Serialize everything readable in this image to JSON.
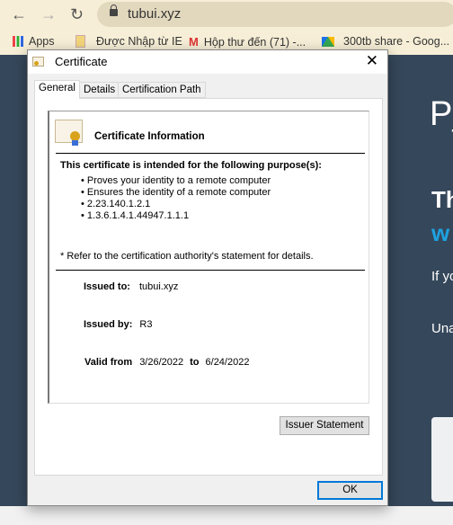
{
  "browser": {
    "url": "tubui.xyz",
    "bookmarks": [
      "Apps",
      "Được Nhập từ IE",
      "Hộp thư đến (71) -...",
      "300tb share - Goog..."
    ]
  },
  "page": {
    "logo": "P_",
    "heading1": "Th",
    "heading2": "w",
    "text1": "If yo",
    "text2": "Una"
  },
  "dialog": {
    "title": "Certificate",
    "tabs": [
      "General",
      "Details",
      "Certification Path"
    ],
    "info_title": "Certificate Information",
    "purpose_heading": "This certificate is intended for the following purpose(s):",
    "purposes": [
      "Proves your identity to a remote computer",
      "Ensures the identity of a remote computer",
      "2.23.140.1.2.1",
      "1.3.6.1.4.1.44947.1.1.1"
    ],
    "note": "* Refer to the certification authority's statement for details.",
    "issued_to_label": "Issued to:",
    "issued_to": "tubui.xyz",
    "issued_by_label": "Issued by:",
    "issued_by": "R3",
    "valid_from_label": "Valid from",
    "valid_from": "3/26/2022",
    "to_label": "to",
    "valid_to": "6/24/2022",
    "issuer_statement_button": "Issuer Statement",
    "ok_button": "OK"
  }
}
